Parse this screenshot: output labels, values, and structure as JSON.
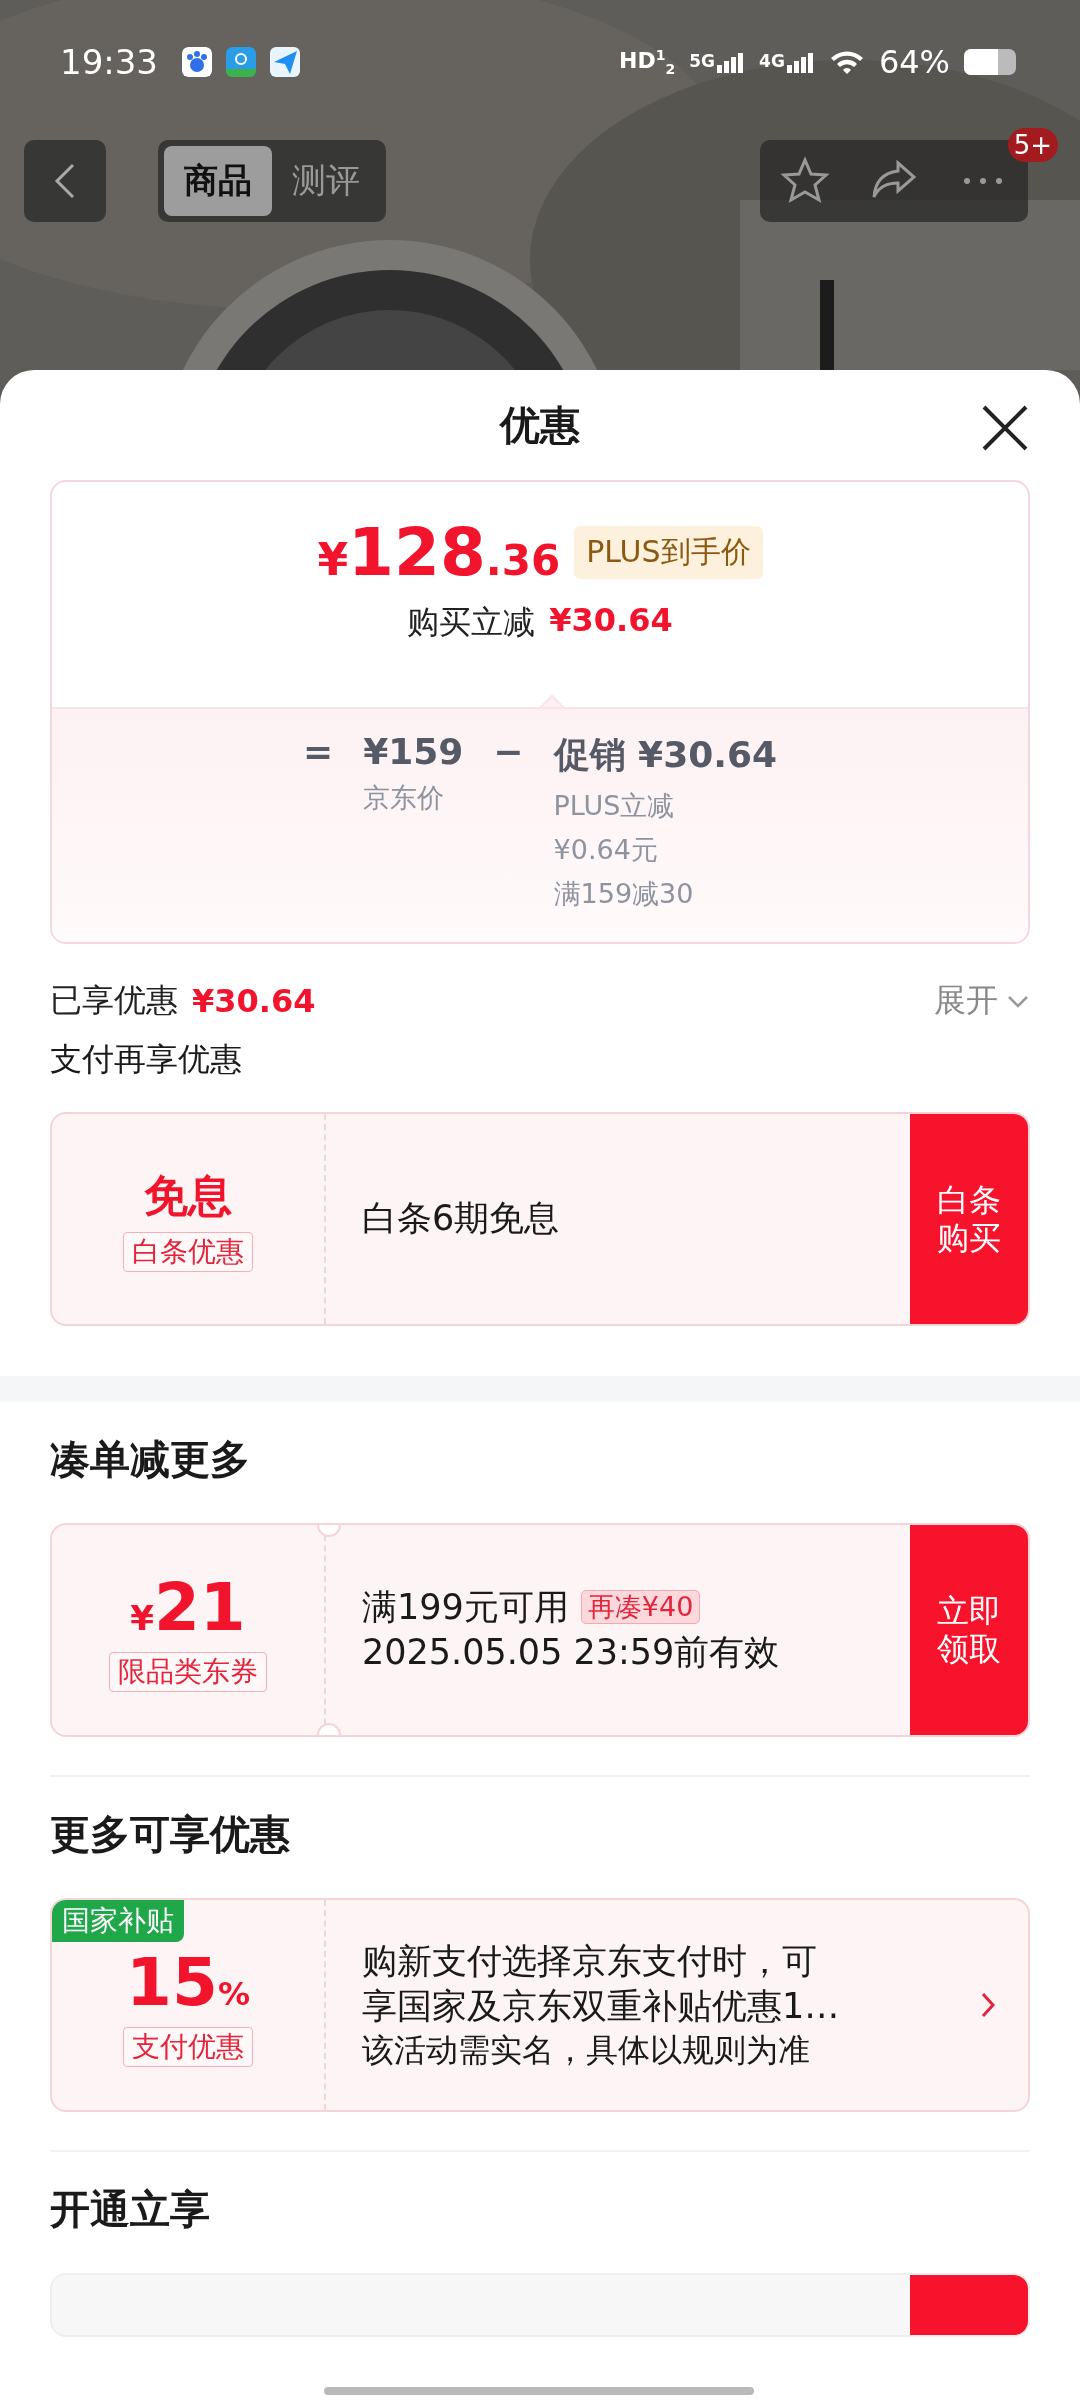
{
  "status_bar": {
    "time": "19:33",
    "hd": "HD$^{1}$$_{2}$",
    "networks": [
      "5G",
      "4G"
    ],
    "battery": "64%"
  },
  "nav": {
    "tabs": [
      {
        "label": "商品",
        "selected": true
      },
      {
        "label": "测评",
        "selected": false
      }
    ],
    "badge": "5+"
  },
  "sheet": {
    "title": "优惠"
  },
  "price_card": {
    "currency": "¥",
    "price_int": "128",
    "price_dec": ".36",
    "tag": "PLUS到手价",
    "instant_label": "购买立减",
    "instant_amount": "¥30.64",
    "equals": "=",
    "jd_price": "¥159",
    "jd_label": "京东价",
    "minus": "−",
    "promo_label": "促销",
    "promo_amount": "¥30.64",
    "promo_details": [
      "PLUS立减",
      "¥0.64元",
      "满159减30"
    ]
  },
  "enjoyed": {
    "label": "已享优惠",
    "amount": "¥30.64",
    "expand": "展开"
  },
  "sections": [
    {
      "title": "支付再享优惠",
      "small": true,
      "cards": [
        {
          "kind": "button",
          "main": "免息",
          "tag": "白条优惠",
          "lines": [
            "白条6期免息"
          ],
          "action": "白条购买"
        }
      ]
    },
    {
      "title": "凑单减更多",
      "small": false,
      "cards": [
        {
          "kind": "button",
          "notched": true,
          "currency": "¥",
          "main": "21",
          "tag": "限品类东券",
          "title": "满199元可用",
          "pill": "再凑¥40",
          "lines": [
            "2025.05.05 23:59前有效"
          ],
          "action": "立即领取"
        }
      ]
    },
    {
      "title": "更多可享优惠",
      "small": false,
      "cards": [
        {
          "kind": "arrow",
          "corner": "国家补贴",
          "main": "15",
          "unit": "%",
          "tag": "支付优惠",
          "lines": [
            "购新支付选择京东支付时，可",
            "享国家及京东双重补贴优惠1…",
            "该活动需实名，具体以规则为准"
          ]
        }
      ]
    },
    {
      "title": "开通立享",
      "small": false,
      "cards": [
        {
          "kind": "partial"
        }
      ]
    }
  ]
}
